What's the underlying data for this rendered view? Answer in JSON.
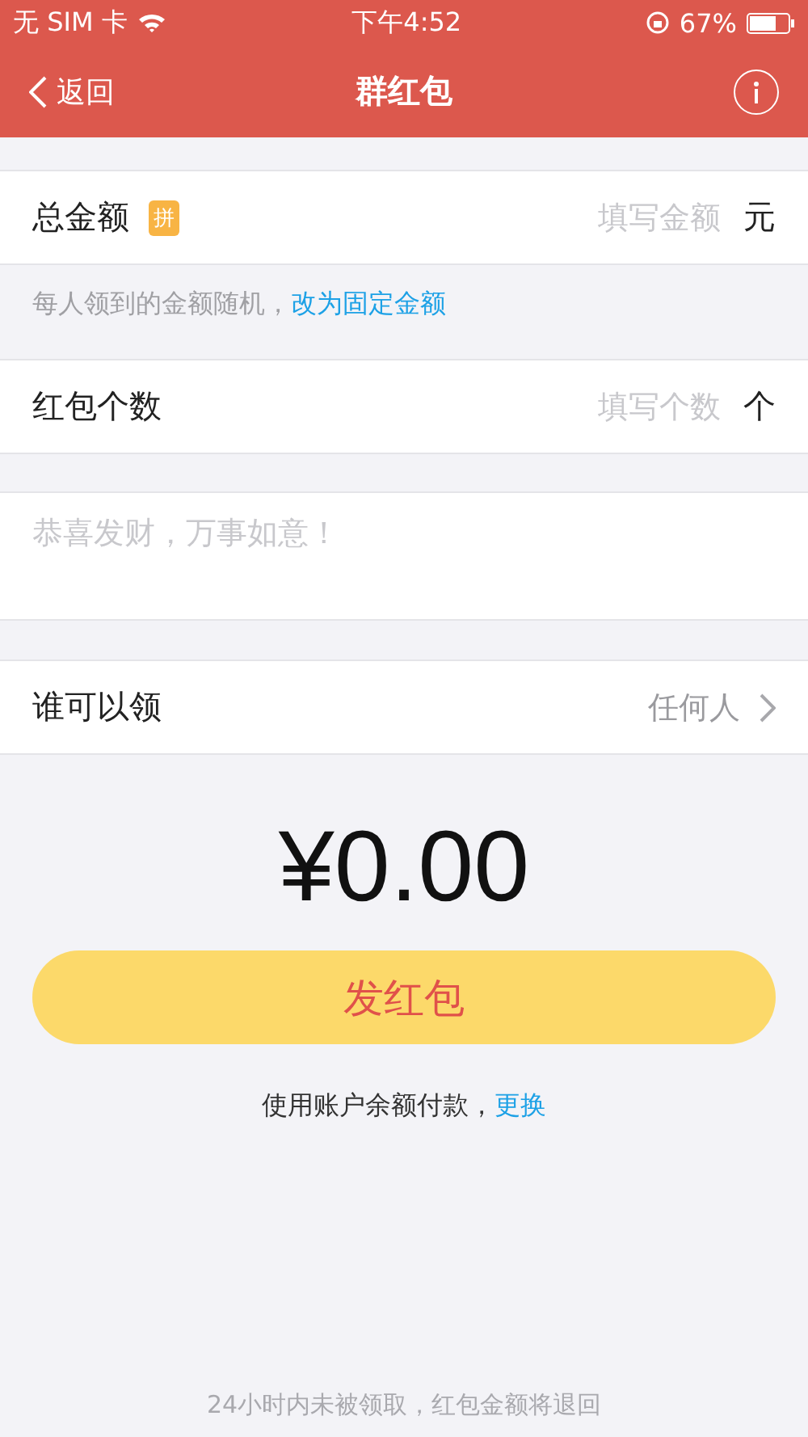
{
  "status_bar": {
    "carrier": "无 SIM 卡",
    "time": "下午4:52",
    "battery": "67%"
  },
  "nav": {
    "back": "返回",
    "title": "群红包"
  },
  "amount_row": {
    "label": "总金额",
    "badge": "拼",
    "placeholder": "填写金额",
    "unit": "元"
  },
  "hint": {
    "text": "每人领到的金额随机，",
    "link": "改为固定金额"
  },
  "count_row": {
    "label": "红包个数",
    "placeholder": "填写个数",
    "unit": "个"
  },
  "message": {
    "placeholder": "恭喜发财，万事如意！"
  },
  "receiver_row": {
    "label": "谁可以领",
    "value": "任何人"
  },
  "total": "¥0.00",
  "send_button": "发红包",
  "payment": {
    "text": "使用账户余额付款，",
    "link": "更换"
  },
  "footer": "24小时内未被领取，红包金额将退回"
}
